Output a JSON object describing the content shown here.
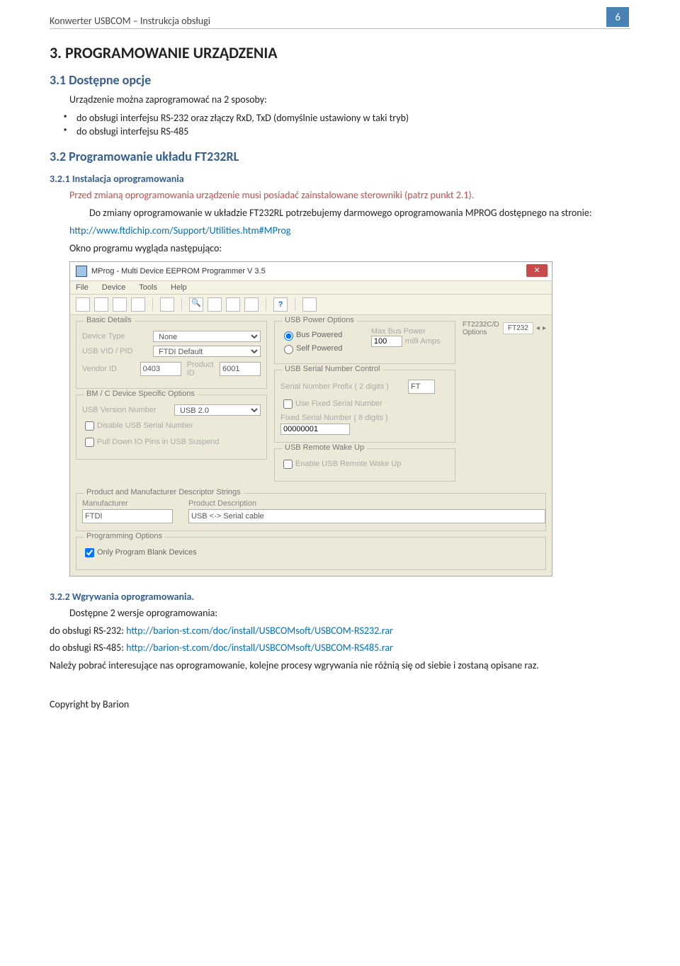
{
  "header": {
    "doc_title": "Konwerter USBCOM – Instrukcja obsługi",
    "page_number": "6"
  },
  "section": {
    "h1": "3. PROGRAMOWANIE URZĄDZENIA",
    "h2_1": "3.1 Dostępne opcje",
    "p1": "Urządzenie można zaprogramować na 2 sposoby:",
    "bul1": "do obsługi interfejsu RS-232 oraz złączy RxD, TxD (domyślnie ustawiony w taki tryb)",
    "bul2": "do obsługi interfejsu RS-485",
    "h2_2": "3.2 Programowanie układu FT232RL",
    "h3_1": "3.2.1 Instalacja oprogramowania",
    "p_red": "Przed zmianą oprogramowania urządzenie musi posiadać zainstalowane sterowniki (patrz punkt 2.1).",
    "p2a": "Do zmiany oprogramowanie w układzie FT232RL potrzebujemy darmowego oprogramowania MPROG dostępnego na stronie:",
    "p2_link": "http://www.ftdichip.com/Support/Utilities.htm#MProg",
    "p3": "Okno programu wygląda następująco:",
    "h3_2": "3.2.2 Wgrywania oprogramowania.",
    "p4": "Dostępne 2 wersje oprogramowania:",
    "p5a": "do obsługi RS-232: ",
    "p5_link": "http://barion-st.com/doc/install/USBCOMsoft/USBCOM-RS232.rar",
    "p6a": "do obsługi RS-485: ",
    "p6_link": "http://barion-st.com/doc/install/USBCOMsoft/USBCOM-RS485.rar",
    "p7": "Należy pobrać interesujące nas oprogramowanie, kolejne procesy wgrywania nie różnią się od siebie i zostaną opisane raz."
  },
  "mprog": {
    "title": "MProg - Multi Device EEPROM Programmer V 3.5",
    "menu": {
      "file": "File",
      "device": "Device",
      "tools": "Tools",
      "help": "Help"
    },
    "tab_label": "FT2232C/D Options",
    "tab_value": "FT232",
    "basic": {
      "legend": "Basic Details",
      "device_type_lbl": "Device Type",
      "device_type": "None",
      "vidpid_lbl": "USB VID / PID",
      "vidpid": "FTDI Default",
      "vendor_lbl": "Vendor ID",
      "vendor": "0403",
      "product_lbl": "Product ID",
      "product": "6001"
    },
    "bmc": {
      "legend": "BM / C Device Specific Options",
      "usb_ver_lbl": "USB Version Number",
      "usb_ver": "USB 2.0",
      "chk1": "Disable USB Serial Number",
      "chk2": "Pull Down IO Pins in USB Suspend"
    },
    "power": {
      "legend": "USB Power Options",
      "bus": "Bus Powered",
      "self": "Self Powered",
      "max_lbl": "Max Bus Power",
      "val": "100",
      "unit": "milli Amps"
    },
    "serial": {
      "legend": "USB Serial Number Control",
      "prefix_lbl": "Serial Number Prefix ( 2 digits )",
      "prefix": "FT",
      "chk_fixed": "Use Fixed Serial Number",
      "fixed_lbl": "Fixed Serial Number ( 8 digits )",
      "fixed": "00000001"
    },
    "wake": {
      "legend": "USB Remote Wake Up",
      "chk": "Enable USB Remote Wake Up"
    },
    "desc": {
      "legend": "Product and Manufacturer Descriptor Strings",
      "man_lbl": "Manufacturer",
      "man": "FTDI",
      "prod_lbl": "Product Description",
      "prod": "USB <-> Serial cable"
    },
    "prog": {
      "legend": "Programming Options",
      "chk": "Only Program Blank Devices"
    }
  },
  "footer": {
    "copyright": "Copyright by Barion"
  }
}
